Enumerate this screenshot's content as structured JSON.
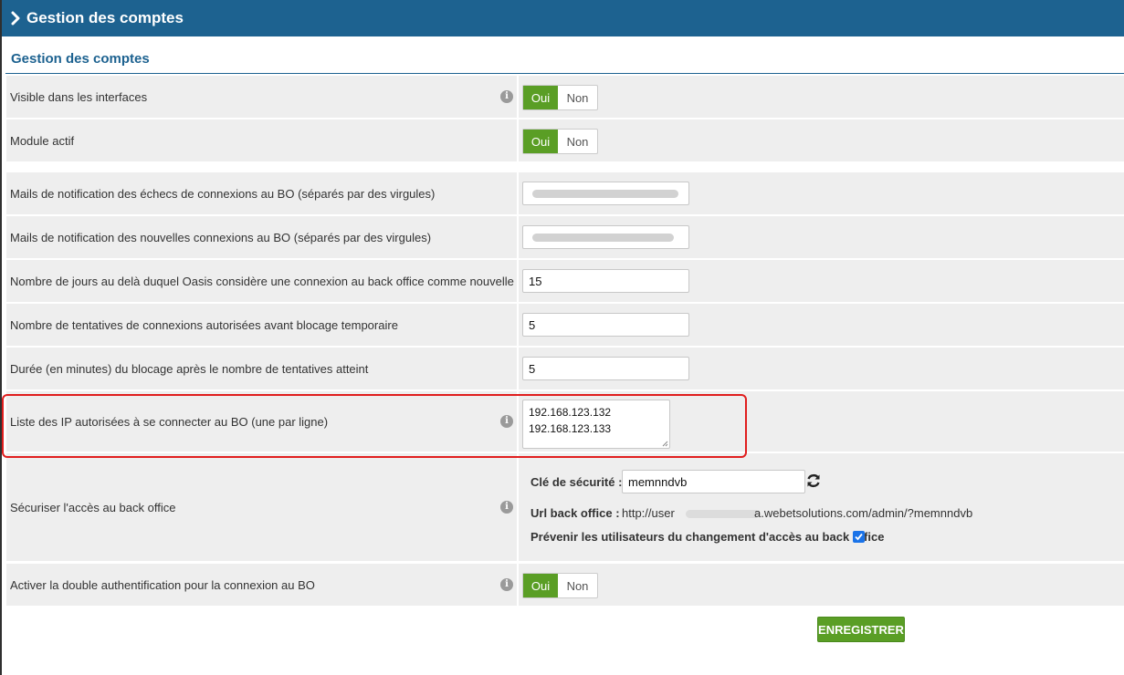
{
  "header": {
    "title": "Gestion des comptes"
  },
  "section": {
    "title": "Gestion des comptes"
  },
  "rows": [
    {
      "label": "Visible dans les interfaces",
      "type": "toggle",
      "selected": "Oui",
      "on_label": "Oui",
      "off_label": "Non",
      "info": true
    },
    {
      "label": "Module actif",
      "type": "toggle",
      "selected": "Oui",
      "on_label": "Oui",
      "off_label": "Non",
      "info": false
    },
    {
      "label": "Mails de notification des échecs de connexions au BO (séparés par des virgules)",
      "type": "text",
      "value": ""
    },
    {
      "label": "Mails de notification des nouvelles connexions au BO (séparés par des virgules)",
      "type": "text",
      "value": ""
    },
    {
      "label": "Nombre de jours au delà duquel Oasis considère une connexion au back office comme nouvelle",
      "type": "text",
      "value": "15"
    },
    {
      "label": "Nombre de tentatives de connexions autorisées avant blocage temporaire",
      "type": "text",
      "value": "5"
    },
    {
      "label": "Durée (en minutes) du blocage après le nombre de tentatives atteint",
      "type": "text",
      "value": "5"
    },
    {
      "label": "Liste des IP autorisées à se connecter au BO (une par ligne)",
      "type": "textarea",
      "lines": [
        "192.168.123.132",
        "192.168.123.133"
      ],
      "info": true
    },
    {
      "label": "Sécuriser l'accès au back office",
      "type": "security",
      "info": true
    },
    {
      "label": "Activer la double authentification pour la connexion au BO",
      "type": "toggle",
      "selected": "Oui",
      "on_label": "Oui",
      "off_label": "Non",
      "info": true
    }
  ],
  "security": {
    "key_label": "Clé de sécurité :",
    "key_value": "memnndvb",
    "url_label": "Url back office :",
    "url_prefix": "http://user",
    "url_suffix": "a.webetsolutions.com/admin/?memnndvb",
    "notify_label": "Prévenir les utilisateurs du changement d'accès au back office",
    "notify_checked": true
  },
  "save_label": "ENREGISTRER",
  "colors": {
    "header": "#1d6290",
    "accent_green": "#5a9e25",
    "highlight": "#e01e1e",
    "row_bg": "#eeeeee"
  }
}
